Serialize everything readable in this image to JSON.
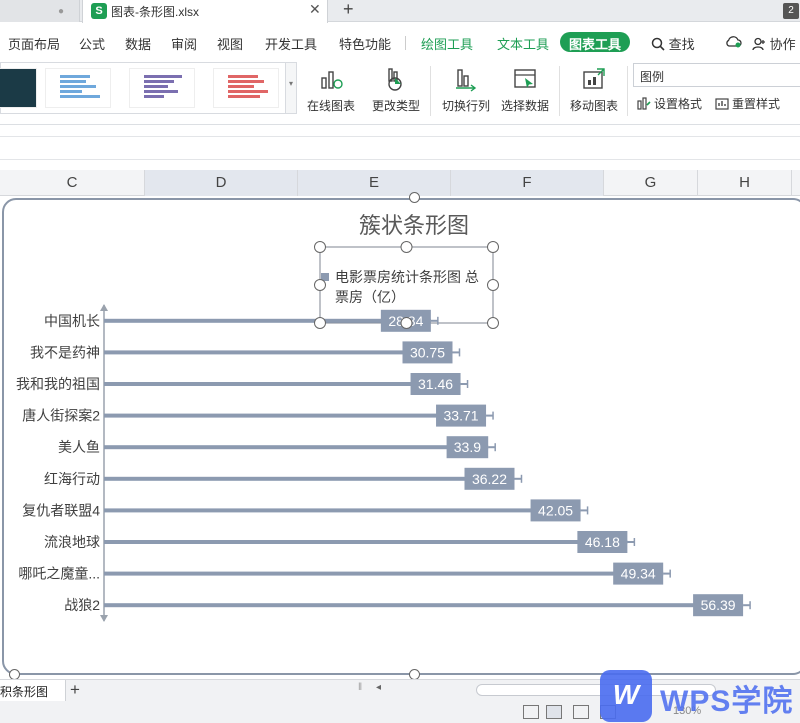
{
  "window": {
    "prev_tab_dot": "●",
    "file_icon": "S",
    "file_tab_title": "图表-条形图.xlsx",
    "close_glyph": "✕",
    "add_glyph": "+",
    "badge": "2"
  },
  "menu": {
    "items": [
      "页面布局",
      "公式",
      "数据",
      "审阅",
      "视图",
      "开发工具",
      "特色功能"
    ],
    "tool_tabs": [
      "绘图工具",
      "文本工具",
      "图表工具"
    ],
    "search": "查找",
    "collab": "协作"
  },
  "ribbon": {
    "online_chart": "在线图表",
    "change_type": "更改类型",
    "switch_row_col": "切换行列",
    "select_data": "选择数据",
    "move_chart": "移动图表",
    "element_select": "图例",
    "set_format": "设置格式",
    "reset_style": "重置样式",
    "colors": {
      "accent_green": "#1e9e54",
      "chart_bar": "#8c9ab0"
    }
  },
  "columns": [
    "C",
    "D",
    "E",
    "F",
    "G",
    "H"
  ],
  "sheet": {
    "tab_label": "堆积条形图",
    "add_glyph": "+",
    "zoom": "130%"
  },
  "watermark": {
    "logo": "W",
    "text": "WPS学院"
  },
  "chart_data": {
    "type": "bar",
    "orientation": "horizontal",
    "title": "簇状条形图",
    "legend": "电影票房统计条形图 总票房（亿）",
    "legend_placement": "top-center",
    "categories": [
      "中国机长",
      "我不是药神",
      "我和我的祖国",
      "唐人街探案2",
      "美人鱼",
      "红海行动",
      "复仇者联盟4",
      "流浪地球",
      "哪吒之魔童...",
      "战狼2"
    ],
    "series": [
      {
        "name": "电影票房统计条形图 总票房（亿）",
        "values": [
          28.84,
          30.75,
          31.46,
          33.71,
          33.9,
          36.22,
          42.05,
          46.18,
          49.34,
          56.39
        ]
      }
    ],
    "xlim": [
      0,
      60
    ],
    "error_bars": true,
    "data_labels": true,
    "grid": false
  }
}
